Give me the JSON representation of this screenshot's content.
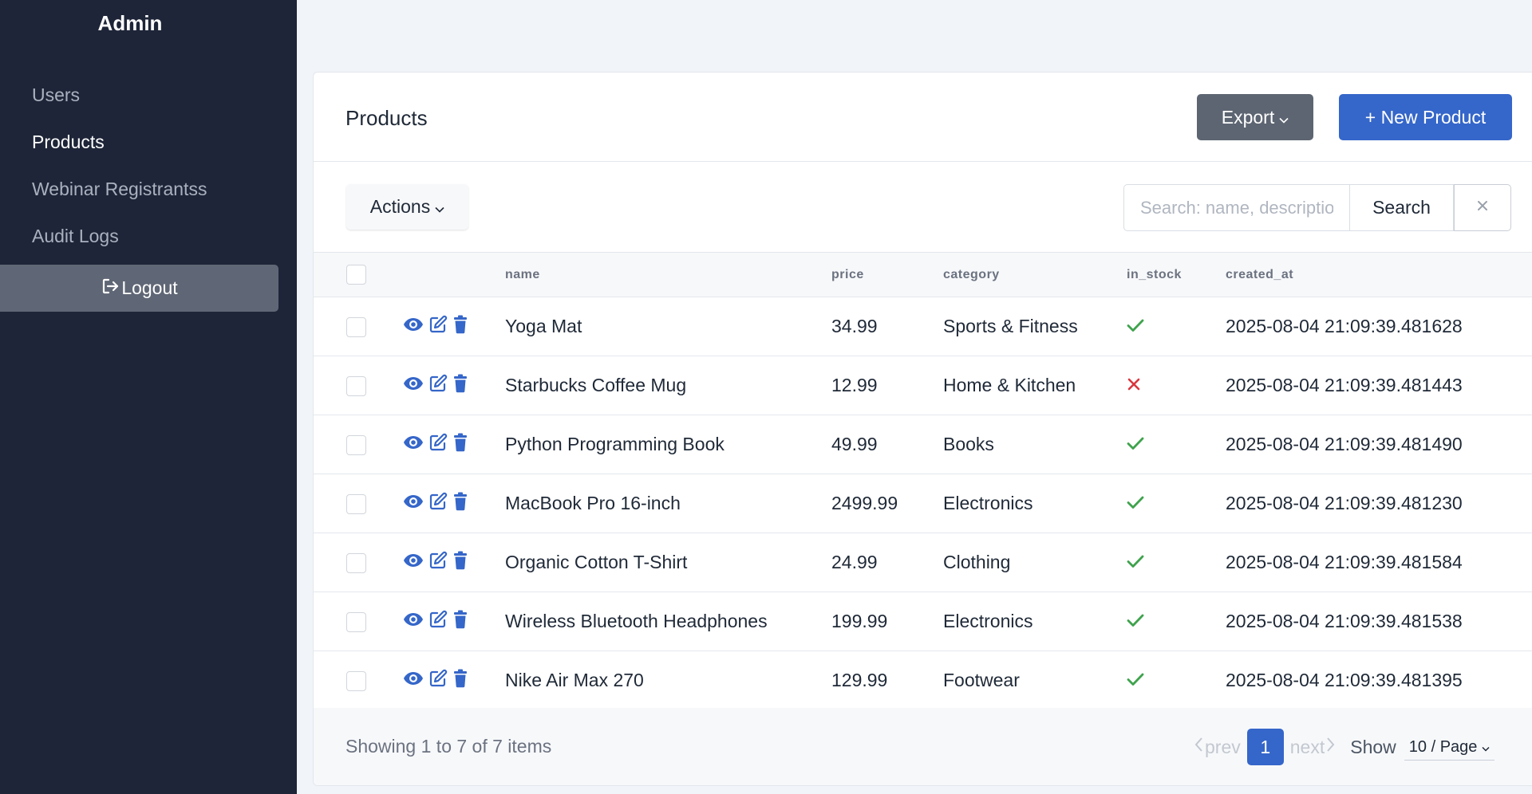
{
  "sidebar": {
    "brand": "Admin",
    "items": [
      {
        "label": "Users"
      },
      {
        "label": "Products"
      },
      {
        "label": "Webinar Registrantss"
      },
      {
        "label": "Audit Logs"
      }
    ],
    "active_item": "Products",
    "logout_label": "Logout"
  },
  "header": {
    "title": "Products",
    "export_label": "Export",
    "new_label": "+ New Product"
  },
  "toolbar": {
    "actions_label": "Actions",
    "search_placeholder": "Search: name, description",
    "search_value": "",
    "search_button": "Search"
  },
  "table": {
    "columns": [
      "name",
      "price",
      "category",
      "in_stock",
      "created_at"
    ],
    "rows": [
      {
        "name": "Yoga Mat",
        "price": "34.99",
        "category": "Sports & Fitness",
        "in_stock": true,
        "created_at": "2025-08-04 21:09:39.481628"
      },
      {
        "name": "Starbucks Coffee Mug",
        "price": "12.99",
        "category": "Home & Kitchen",
        "in_stock": false,
        "created_at": "2025-08-04 21:09:39.481443"
      },
      {
        "name": "Python Programming Book",
        "price": "49.99",
        "category": "Books",
        "in_stock": true,
        "created_at": "2025-08-04 21:09:39.481490"
      },
      {
        "name": "MacBook Pro 16-inch",
        "price": "2499.99",
        "category": "Electronics",
        "in_stock": true,
        "created_at": "2025-08-04 21:09:39.481230"
      },
      {
        "name": "Organic Cotton T-Shirt",
        "price": "24.99",
        "category": "Clothing",
        "in_stock": true,
        "created_at": "2025-08-04 21:09:39.481584"
      },
      {
        "name": "Wireless Bluetooth Headphones",
        "price": "199.99",
        "category": "Electronics",
        "in_stock": true,
        "created_at": "2025-08-04 21:09:39.481538"
      },
      {
        "name": "Nike Air Max 270",
        "price": "129.99",
        "category": "Footwear",
        "in_stock": true,
        "created_at": "2025-08-04 21:09:39.481395"
      }
    ]
  },
  "footer": {
    "showing": "Showing 1 to 7 of 7 items",
    "prev_label": "prev",
    "next_label": "next",
    "current_page": "1",
    "show_label": "Show",
    "per_page": "10 / Page"
  },
  "colors": {
    "sidebar_bg": "#1e2538",
    "primary": "#3566c9",
    "secondary": "#5d6572",
    "check": "#3fa34d",
    "cross": "#d9363e"
  },
  "icons": {
    "logout": "sign-out-icon",
    "row_actions": [
      "eye-icon",
      "edit-icon",
      "trash-icon"
    ],
    "in_stock_true": "check-icon",
    "in_stock_false": "x-icon"
  }
}
